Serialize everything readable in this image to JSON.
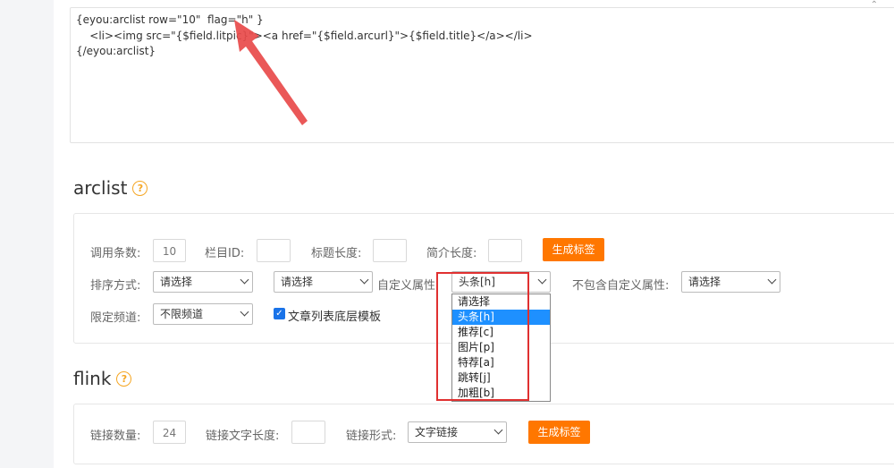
{
  "code": {
    "lines": [
      "{eyou:arclist row=\"10\"  flag=\"h\" }",
      "    <li><img src=\"{$field.litpic}\"><a href=\"{$field.arcurl}\">{$field.title}</a></li>",
      "{/eyou:arclist}"
    ],
    "topright_icon": "chevron-up-icon"
  },
  "arclist": {
    "title": "arclist",
    "fields": {
      "count_label": "调用条数:",
      "count_value": "10",
      "column_id_label": "栏目ID:",
      "column_id_value": "",
      "title_len_label": "标题长度:",
      "title_len_value": "",
      "intro_len_label": "简介长度:",
      "intro_len_value": "",
      "generate_button": "生成标签",
      "sort_label": "排序方式:",
      "sort_select_1": "请选择",
      "sort_select_2": "请选择",
      "custom_attr_label": "自定义属性:",
      "custom_attr_value": "头条[h]",
      "exclude_attr_label": "不包含自定义属性:",
      "exclude_attr_value": "请选择",
      "channel_label": "限定频道:",
      "channel_value": "不限频道",
      "checkbox_label": "文章列表底层模板"
    },
    "dropdown_options": [
      "请选择",
      "头条[h]",
      "推荐[c]",
      "图片[p]",
      "特荐[a]",
      "跳转[j]",
      "加粗[b]"
    ],
    "dropdown_selected": 1
  },
  "flink": {
    "title": "flink",
    "fields": {
      "count_label": "链接数量:",
      "count_value": "24",
      "text_len_label": "链接文字长度:",
      "text_len_value": "",
      "form_label": "链接形式:",
      "form_value": "文字链接",
      "generate_button": "生成标签"
    }
  },
  "colors": {
    "accent": "#ff7700",
    "help": "#f5a623",
    "highlight": "#e03030",
    "selected": "#1e90ff"
  }
}
